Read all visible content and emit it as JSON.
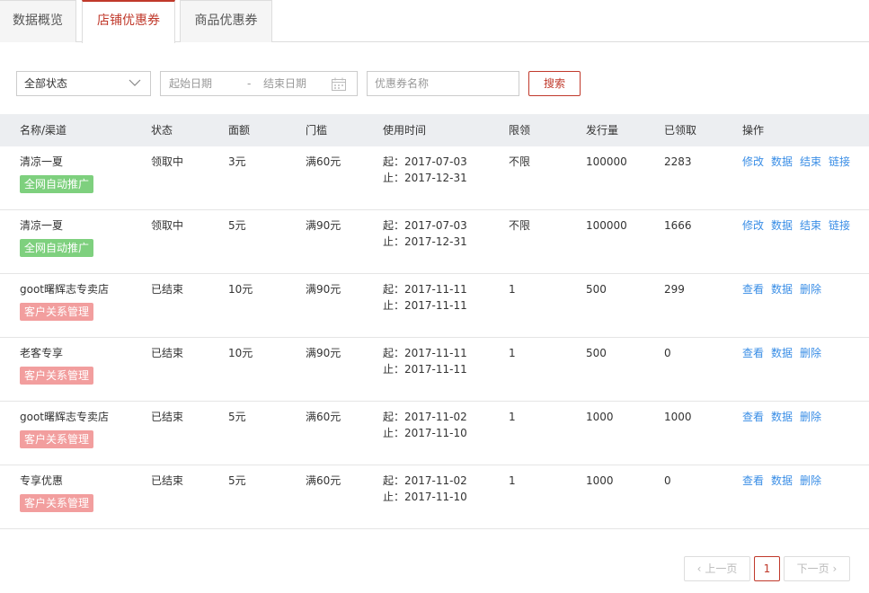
{
  "tabs": [
    {
      "label": "数据概览"
    },
    {
      "label": "店铺优惠券"
    },
    {
      "label": "商品优惠券"
    }
  ],
  "filters": {
    "status_value": "全部状态",
    "start_date_placeholder": "起始日期",
    "date_separator": "-",
    "end_date_placeholder": "结束日期",
    "name_placeholder": "优惠券名称",
    "search_label": "搜索"
  },
  "table": {
    "headers": [
      "名称/渠道",
      "状态",
      "面额",
      "门槛",
      "使用时间",
      "限领",
      "发行量",
      "已领取",
      "操作"
    ],
    "rows": [
      {
        "name": "清凉一夏",
        "channel": "全网自动推广",
        "status": "领取中",
        "face": "3元",
        "threshold": "满60元",
        "start": "起：2017-07-03",
        "end": "止：2017-12-31",
        "limit": "不限",
        "issued": "100000",
        "claimed": "2283",
        "ops": [
          "修改",
          "数据",
          "结束",
          "链接"
        ]
      },
      {
        "name": "清凉一夏",
        "channel": "全网自动推广",
        "status": "领取中",
        "face": "5元",
        "threshold": "满90元",
        "start": "起：2017-07-03",
        "end": "止：2017-12-31",
        "limit": "不限",
        "issued": "100000",
        "claimed": "1666",
        "ops": [
          "修改",
          "数据",
          "结束",
          "链接"
        ]
      },
      {
        "name": "goot曙辉志专卖店",
        "channel": "客户关系管理",
        "status": "已结束",
        "face": "10元",
        "threshold": "满90元",
        "start": "起：2017-11-11",
        "end": "止：2017-11-11",
        "limit": "1",
        "issued": "500",
        "claimed": "299",
        "ops": [
          "查看",
          "数据",
          "删除"
        ]
      },
      {
        "name": "老客专享",
        "channel": "客户关系管理",
        "status": "已结束",
        "face": "10元",
        "threshold": "满90元",
        "start": "起：2017-11-11",
        "end": "止：2017-11-11",
        "limit": "1",
        "issued": "500",
        "claimed": "0",
        "ops": [
          "查看",
          "数据",
          "删除"
        ]
      },
      {
        "name": "goot曙辉志专卖店",
        "channel": "客户关系管理",
        "status": "已结束",
        "face": "5元",
        "threshold": "满60元",
        "start": "起：2017-11-02",
        "end": "止：2017-11-10",
        "limit": "1",
        "issued": "1000",
        "claimed": "1000",
        "ops": [
          "查看",
          "数据",
          "删除"
        ]
      },
      {
        "name": "专享优惠",
        "channel": "客户关系管理",
        "status": "已结束",
        "face": "5元",
        "threshold": "满60元",
        "start": "起：2017-11-02",
        "end": "止：2017-11-10",
        "limit": "1",
        "issued": "1000",
        "claimed": "0",
        "ops": [
          "查看",
          "数据",
          "删除"
        ]
      }
    ]
  },
  "pagination": {
    "prev_label": "上一页",
    "current_page": "1",
    "next_label": "下一页"
  },
  "colors": {
    "accent": "#c0392b",
    "badge_auto": "#7ed07e",
    "badge_crm": "#f29e9e",
    "link": "#3a8ee6"
  },
  "icons": {
    "status_dropdown": "chevron-down-icon",
    "date": "calendar-icon",
    "prev": "chevron-left-icon",
    "next": "chevron-right-icon"
  }
}
